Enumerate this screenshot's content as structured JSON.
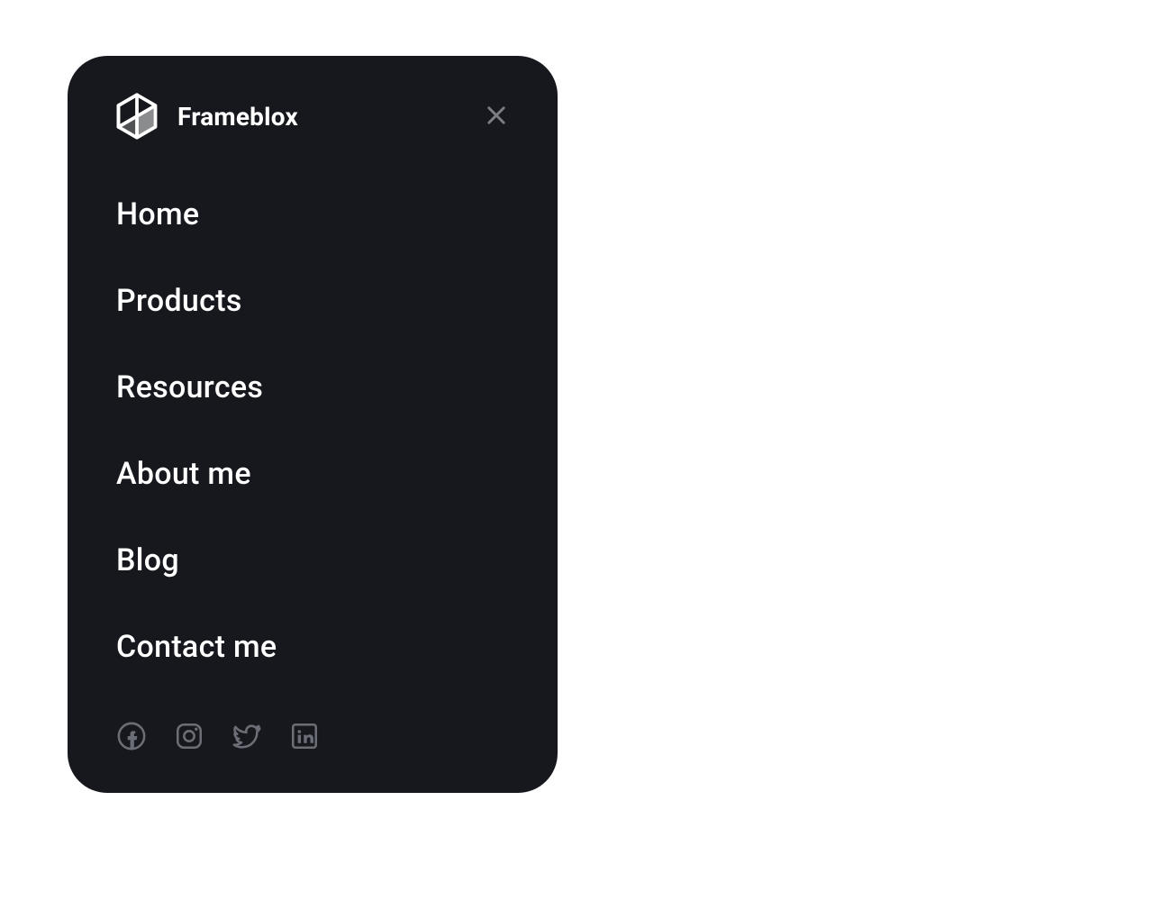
{
  "brand": {
    "name": "Frameblox"
  },
  "nav": {
    "items": [
      {
        "label": "Home"
      },
      {
        "label": "Products"
      },
      {
        "label": "Resources"
      },
      {
        "label": "About me"
      },
      {
        "label": "Blog"
      },
      {
        "label": "Contact me"
      }
    ]
  },
  "social": {
    "items": [
      {
        "name": "facebook"
      },
      {
        "name": "instagram"
      },
      {
        "name": "twitter"
      },
      {
        "name": "linkedin"
      }
    ]
  }
}
